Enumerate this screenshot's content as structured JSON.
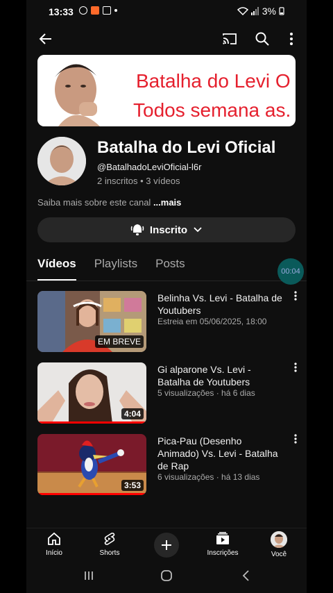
{
  "status_bar": {
    "time": "13:33",
    "battery": "3%"
  },
  "banner": {
    "line1": "Batalha do Levi O",
    "line2": "Todos semana as."
  },
  "channel": {
    "name": "Batalha do Levi Oficial",
    "handle": "@BatalhadoLeviOficial-l6r",
    "stats": "2 inscritos • 3 vídeos",
    "about_text": "Saiba mais sobre este canal ",
    "about_more": "...mais",
    "subscribe_label": "Inscrito"
  },
  "tabs": [
    {
      "label": "Vídeos",
      "active": true
    },
    {
      "label": "Playlists",
      "active": false
    },
    {
      "label": "Posts",
      "active": false
    }
  ],
  "timer_bubble": "00:04",
  "videos": [
    {
      "title": "Belinha Vs. Levi - Batalha de Youtubers",
      "meta": "Estreia em 05/06/2025, 18:00",
      "badge": "EM BREVE",
      "duration": "",
      "progress": 0
    },
    {
      "title": "Gi alparone Vs. Levi - Batalha de Youtubers",
      "meta": "5 visualizações · há 6 dias",
      "badge": "",
      "duration": "4:04",
      "progress": 1.0
    },
    {
      "title": "Pica-Pau (Desenho Animado) Vs. Levi - Batalha de Rap",
      "meta": "6 visualizações · há 13 dias",
      "badge": "",
      "duration": "3:53",
      "progress": 1.0
    }
  ],
  "bottom_nav": {
    "home": "Início",
    "shorts": "Shorts",
    "subscriptions": "Inscrições",
    "you": "Você"
  },
  "icons": {
    "back": "arrow-left-icon",
    "cast": "cast-icon",
    "search": "search-icon",
    "more": "more-vert-icon",
    "bell": "bell-ring-icon",
    "chevron": "chevron-down-icon"
  },
  "colors": {
    "background": "#0f0f0f",
    "accent_red": "#ff0000",
    "banner_text": "#e5202e"
  }
}
